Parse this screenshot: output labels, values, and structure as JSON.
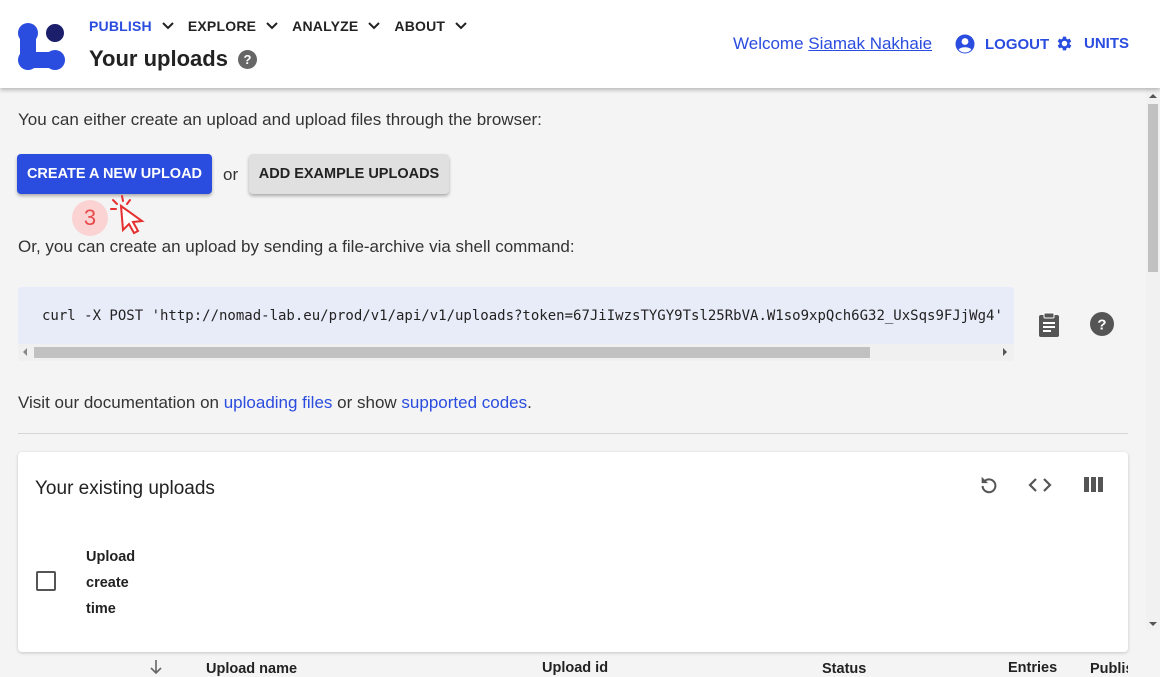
{
  "header": {
    "nav": [
      {
        "label": "PUBLISH",
        "active": true
      },
      {
        "label": "EXPLORE",
        "active": false
      },
      {
        "label": "ANALYZE",
        "active": false
      },
      {
        "label": "ABOUT",
        "active": false
      }
    ],
    "page_title": "Your uploads",
    "welcome_prefix": "Welcome",
    "user_name": "Siamak Nakhaie",
    "logout_label": "LOGOUT",
    "units_label": "UNITS",
    "accent_color": "#2a4cdf"
  },
  "main": {
    "intro_browser": "You can either create an upload and upload files through the browser:",
    "create_button": "CREATE A NEW UPLOAD",
    "or_text": "or",
    "example_button": "ADD EXAMPLE UPLOADS",
    "step_number": "3",
    "intro_shell": "Or, you can create an upload by sending a file-archive via shell command:",
    "shell_command": "curl -X POST 'http://nomad-lab.eu/prod/v1/api/v1/uploads?token=67JiIwzsTYGY9Tsl25RbVA.W1so9xpQch6G32_UxSqs9FJjWg4'",
    "doc_prefix": "Visit our documentation on",
    "doc_link": "uploading files",
    "doc_middle": "or show",
    "codes_link": "supported codes",
    "doc_suffix": "."
  },
  "uploads_table": {
    "title": "Your existing uploads",
    "columns": {
      "create_time_line1": "Upload",
      "create_time_line2": "create",
      "create_time_line3": "time",
      "upload_name": "Upload name",
      "upload_id": "Upload id",
      "status": "Status",
      "entries": "Entries",
      "published": "Publis"
    }
  }
}
